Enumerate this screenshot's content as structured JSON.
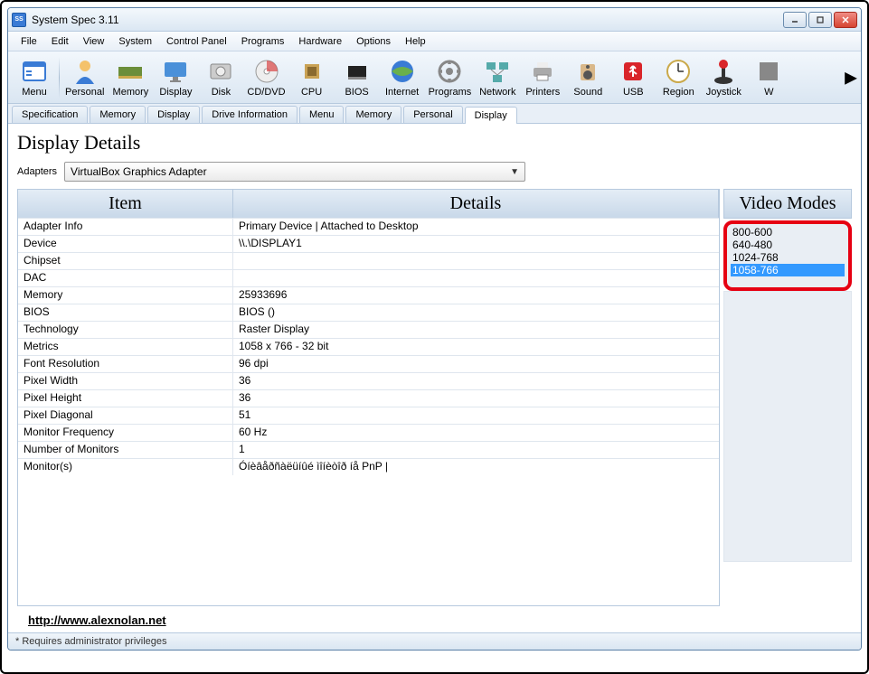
{
  "window": {
    "title": "System Spec 3.11"
  },
  "menu": [
    "File",
    "Edit",
    "View",
    "System",
    "Control Panel",
    "Programs",
    "Hardware",
    "Options",
    "Help"
  ],
  "toolbar": [
    {
      "label": "Menu",
      "icon": "menu"
    },
    {
      "label": "Personal",
      "icon": "personal"
    },
    {
      "label": "Memory",
      "icon": "memory"
    },
    {
      "label": "Display",
      "icon": "display"
    },
    {
      "label": "Disk",
      "icon": "disk"
    },
    {
      "label": "CD/DVD",
      "icon": "cd"
    },
    {
      "label": "CPU",
      "icon": "cpu"
    },
    {
      "label": "BIOS",
      "icon": "bios"
    },
    {
      "label": "Internet",
      "icon": "internet"
    },
    {
      "label": "Programs",
      "icon": "programs"
    },
    {
      "label": "Network",
      "icon": "network"
    },
    {
      "label": "Printers",
      "icon": "printers"
    },
    {
      "label": "Sound",
      "icon": "sound"
    },
    {
      "label": "USB",
      "icon": "usb"
    },
    {
      "label": "Region",
      "icon": "region"
    },
    {
      "label": "Joystick",
      "icon": "joystick"
    },
    {
      "label": "W",
      "icon": "w"
    }
  ],
  "tabs": [
    "Specification",
    "Memory",
    "Display",
    "Drive Information",
    "Menu",
    "Memory",
    "Personal",
    "Display"
  ],
  "active_tab": 7,
  "heading": "Display Details",
  "adapters_label": "Adapters",
  "adapters_value": "VirtualBox Graphics Adapter",
  "columns": {
    "item": "Item",
    "details": "Details",
    "video": "Video Modes"
  },
  "rows": [
    {
      "item": "Adapter Info",
      "details": "Primary Device | Attached to Desktop"
    },
    {
      "item": "Device",
      "details": "\\\\.\\DISPLAY1"
    },
    {
      "item": "Chipset",
      "details": ""
    },
    {
      "item": "DAC",
      "details": ""
    },
    {
      "item": "Memory",
      "details": "25933696"
    },
    {
      "item": "BIOS",
      "details": "BIOS  ()"
    },
    {
      "item": "Technology",
      "details": "Raster Display"
    },
    {
      "item": "Metrics",
      "details": "1058 x 766 - 32 bit"
    },
    {
      "item": "Font Resolution",
      "details": "96 dpi"
    },
    {
      "item": "Pixel Width",
      "details": "36"
    },
    {
      "item": "Pixel Height",
      "details": "36"
    },
    {
      "item": "Pixel Diagonal",
      "details": "51"
    },
    {
      "item": "Monitor Frequency",
      "details": "60 Hz"
    },
    {
      "item": "Number of Monitors",
      "details": "1"
    },
    {
      "item": "Monitor(s)",
      "details": "Óíèâåðñàëüíûé ìîíèòîð íå PnP |"
    }
  ],
  "video_modes": [
    "800-600",
    "640-480",
    "1024-768",
    "1058-766"
  ],
  "video_selected": 3,
  "link": "http://www.alexnolan.net",
  "status": "*  Requires administrator privileges"
}
